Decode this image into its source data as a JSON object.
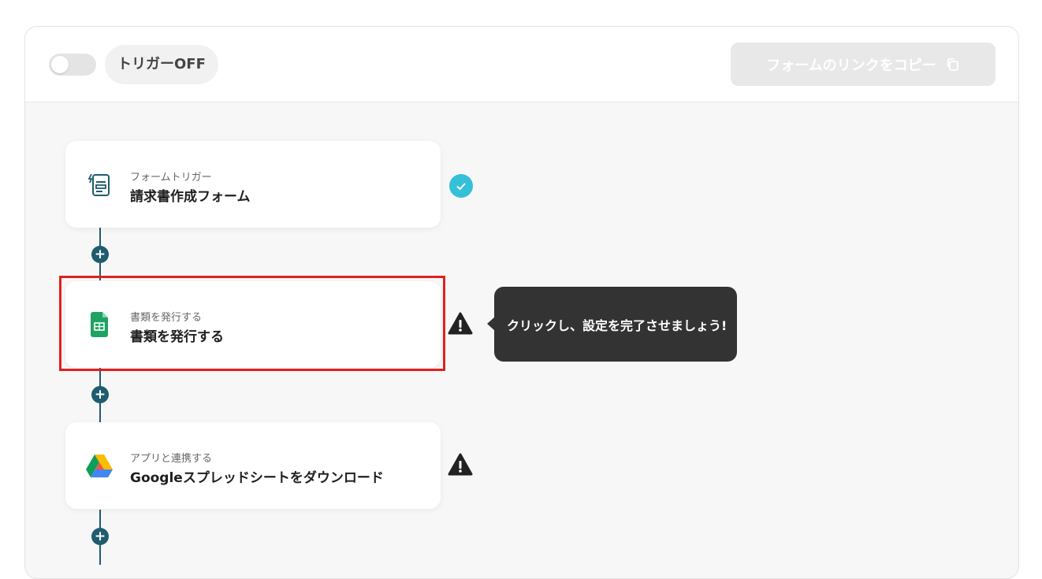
{
  "header": {
    "toggle_state": "off",
    "trigger_status_label": "トリガーOFF",
    "copy_link_label": "フォームのリンクをコピー",
    "copy_icon": "copy-icon"
  },
  "flow": {
    "steps": [
      {
        "subtitle": "フォームトリガー",
        "title": "請求書作成フォーム",
        "icon": "form-trigger-icon",
        "status": "complete",
        "status_color": "#35c0d8"
      },
      {
        "subtitle": "書類を発行する",
        "title": "書類を発行する",
        "icon": "google-sheets-icon",
        "icon_color": "#1ea362",
        "status": "warning",
        "highlighted": true,
        "highlight_color": "#e02020"
      },
      {
        "subtitle": "アプリと連携する",
        "title": "Googleスプレッドシートをダウンロード",
        "icon": "google-drive-icon",
        "status": "warning"
      }
    ],
    "add_step_symbol": "+",
    "connector_color": "#1f5c6e"
  },
  "tooltip": {
    "text": "クリックし、設定を完了させましょう!"
  }
}
